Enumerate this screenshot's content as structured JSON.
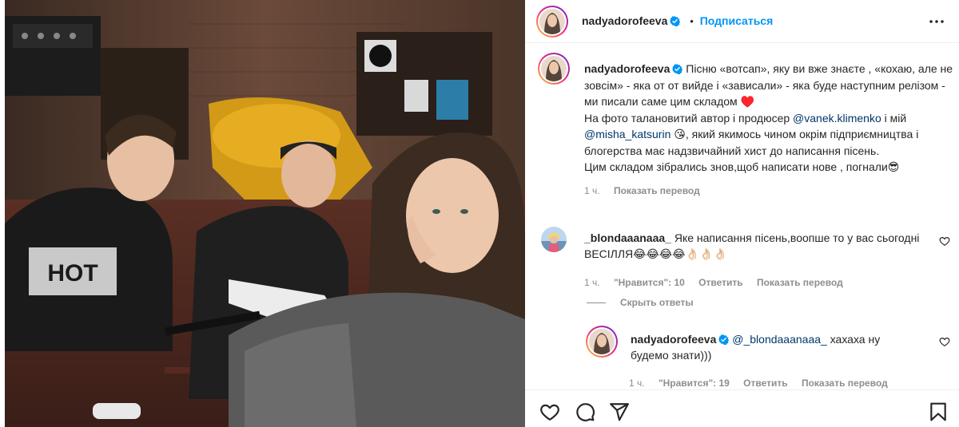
{
  "post": {
    "author": "nadyadorofeeva",
    "follow_label": "Подписаться",
    "separator": "•",
    "caption_parts": {
      "p1": "Пісню «вотсап», яку ви вже знаєте , «кохаю, але не зовсім» - яка от от вийде і «зависали» - яка буде наступним релізом - ми писали саме цим складом ♥️",
      "p2": "На фото талановитий автор і продюсер ",
      "mention1": "@vanek.klimenko",
      "p3": " і мій ",
      "mention2": "@misha_katsurin",
      "p4": " 😘, який якимось чином окрім підприємництва і блогерства має надзвичайний хист до написання пісень.",
      "p5": "Цим складом зібрались знов,щоб написати нове , погнали😎"
    },
    "caption_time": "1 ч.",
    "caption_translate": "Показать перевод"
  },
  "comment": {
    "author": "_blondaaanaaa_",
    "text": " Яке написання пісень,воопше то у вас сьогодні ВЕСІЛЛЯ😂😂😂😂👌🏻👌🏻👌🏻",
    "time": "1 ч.",
    "likes": "\"Нравится\": 10",
    "reply_label": "Ответить",
    "translate_label": "Показать перевод"
  },
  "hide_replies": "Скрыть ответы",
  "reply": {
    "author": "nadyadorofeeva",
    "mention": "@_blondaaanaaa_",
    "text": " хахаха ну будемо знати)))",
    "time": "1 ч.",
    "likes": "\"Нравится\": 19",
    "reply_label": "Ответить",
    "translate_label": "Показать перевод"
  },
  "colors": {
    "link": "#0095f6",
    "mention": "#00376b",
    "muted": "#8e8e8e",
    "verified": "#0095f6"
  },
  "icons": [
    "more-icon",
    "verified-icon",
    "heart-icon",
    "comment-icon",
    "share-icon",
    "bookmark-icon"
  ]
}
